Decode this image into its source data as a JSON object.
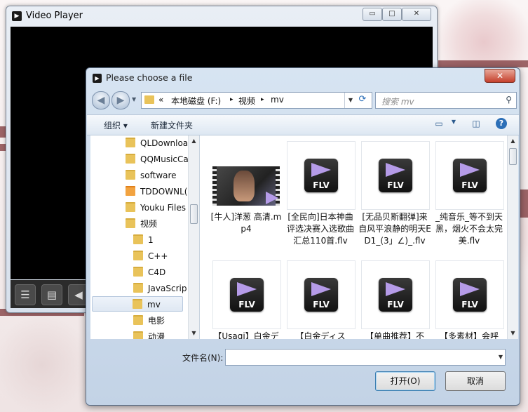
{
  "video_player": {
    "title": "Video Player",
    "controls": {
      "minimize": "▭",
      "maximize": "□",
      "close": "✕"
    },
    "bottom_buttons": [
      "playlist-icon",
      "file-icon",
      "rewind-icon"
    ]
  },
  "dialog": {
    "title": "Please choose a file",
    "close_label": "✕",
    "address": {
      "chevron": "«",
      "parts": [
        "本地磁盘 (F:)",
        "视频",
        "mv"
      ],
      "separator": "▸"
    },
    "search": {
      "placeholder": "搜索 mv"
    },
    "toolbar": {
      "organize": "组织 ▾",
      "new_folder": "新建文件夹",
      "help": "?"
    },
    "tree": [
      {
        "label": "QLDownloa",
        "indent": 0,
        "special": false,
        "selected": false
      },
      {
        "label": "QQMusicCa",
        "indent": 0,
        "special": false,
        "selected": false
      },
      {
        "label": "software",
        "indent": 0,
        "special": false,
        "selected": false
      },
      {
        "label": "TDDOWNL(",
        "indent": 0,
        "special": true,
        "selected": false
      },
      {
        "label": "Youku Files",
        "indent": 0,
        "special": false,
        "selected": false
      },
      {
        "label": "视频",
        "indent": 0,
        "special": false,
        "selected": false
      },
      {
        "label": "1",
        "indent": 1,
        "special": false,
        "selected": false
      },
      {
        "label": "C++",
        "indent": 1,
        "special": false,
        "selected": false
      },
      {
        "label": "C4D",
        "indent": 1,
        "special": false,
        "selected": false
      },
      {
        "label": "JavaScrip",
        "indent": 1,
        "special": false,
        "selected": false
      },
      {
        "label": "mv",
        "indent": 1,
        "special": false,
        "selected": true
      },
      {
        "label": "电影",
        "indent": 1,
        "special": false,
        "selected": false
      },
      {
        "label": "动漫",
        "indent": 1,
        "special": false,
        "selected": false
      }
    ],
    "files": [
      {
        "name": "[牛人]洋葱 高清.mp4",
        "type": "mp4"
      },
      {
        "name": "[全民向]日本神曲评选决赛入选歌曲汇总110首.flv",
        "type": "flv"
      },
      {
        "name": "[无品贝斯翻弹]来自风平浪静的明天ED1_(3」∠)_.flv",
        "type": "flv"
      },
      {
        "name": "_纯音乐_等不到天黑，烟火不会太完美.flv",
        "type": "flv"
      },
      {
        "name": "【Usagi】白金デ",
        "type": "flv"
      },
      {
        "name": "【白金ディス",
        "type": "flv"
      },
      {
        "name": "【单曲推荐】不",
        "type": "flv"
      },
      {
        "name": "【多素材】会呼",
        "type": "flv"
      }
    ],
    "flv_label": "FLV",
    "filename_label": "文件名(N):",
    "filename_value": "",
    "open_button": "打开(O)",
    "cancel_button": "取消"
  }
}
